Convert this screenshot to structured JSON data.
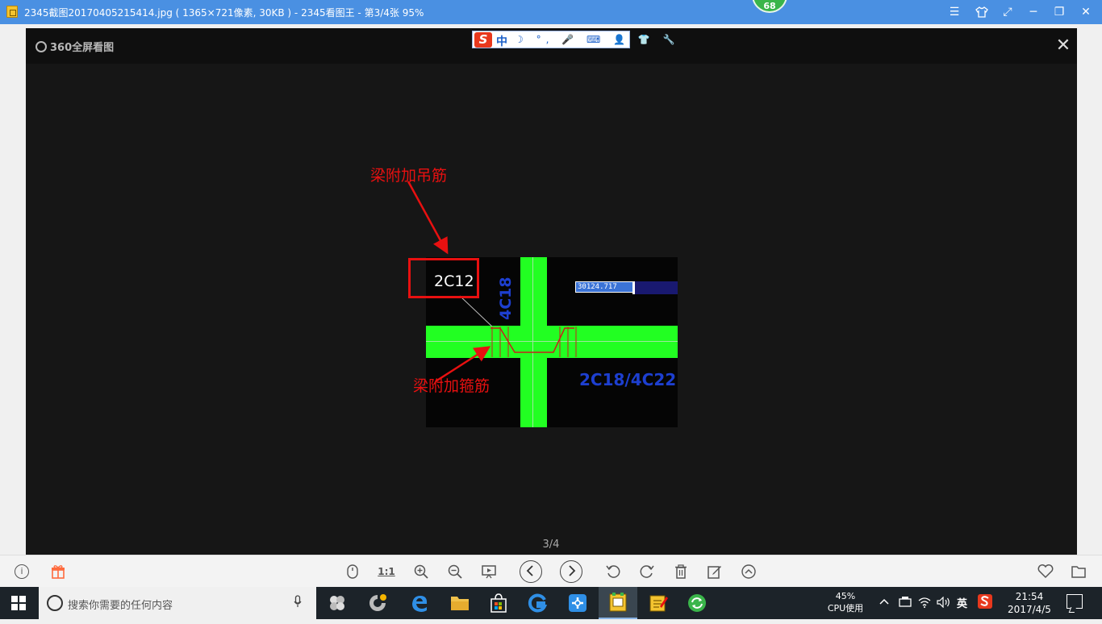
{
  "window": {
    "title": "2345截图20170405215414.jpg ( 1365×721像素, 30KB ) - 2345看图王 - 第3/4张 95%",
    "badge": "68",
    "controls": {
      "menu": "☰",
      "skin": "👕",
      "fullscreen": "⤢",
      "minimize": "─",
      "restore": "❐",
      "close": "✕"
    }
  },
  "viewer": {
    "logo": "360全屏看图",
    "close": "✕",
    "page_indicator": "3/4",
    "ime": {
      "logo": "S",
      "mode": "中",
      "icons": "☽ °, 🎤 ⌨ 👤 👕 🔧"
    }
  },
  "image": {
    "annotation_top": "梁附加吊筋",
    "annotation_bottom": "梁附加箍筋",
    "label_hanger": "2C12",
    "label_vertical": "4C18",
    "label_beam": "2C18/4C22",
    "coordinate": "30124.717"
  },
  "toolbar": {
    "info": "i",
    "one_to_one": "1:1"
  },
  "taskbar": {
    "search_placeholder": "搜索你需要的任何内容",
    "cpu_percent": "45%",
    "cpu_label": "CPU使用",
    "ime_lang": "英",
    "time": "21:54",
    "date": "2017/4/5"
  },
  "colors": {
    "titlebar": "#4a90e2",
    "annotation_red": "#e81010",
    "cad_green": "#22ff22",
    "cad_blue": "#1d3fd0"
  }
}
